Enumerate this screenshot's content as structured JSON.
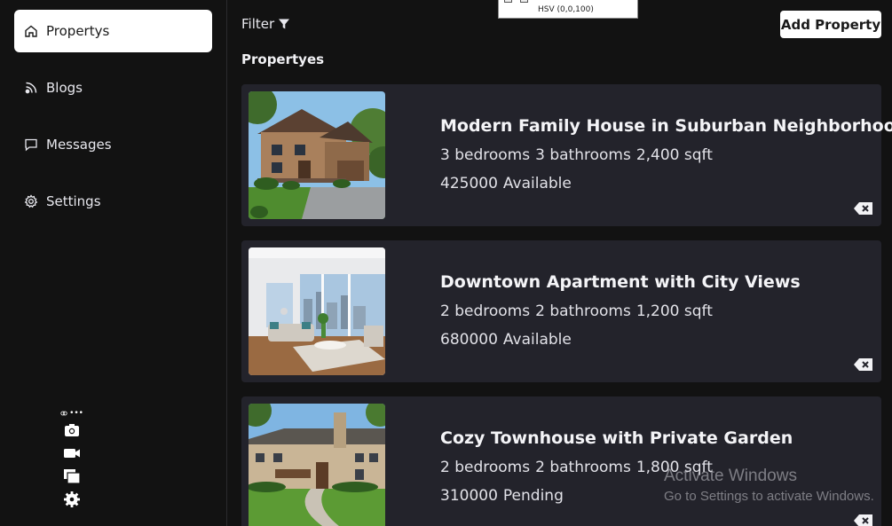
{
  "sidebar": {
    "items": [
      {
        "label": "Propertys",
        "icon": "home-icon",
        "active": true
      },
      {
        "label": "Blogs",
        "icon": "rss-icon",
        "active": false
      },
      {
        "label": "Messages",
        "icon": "message-icon",
        "active": false
      },
      {
        "label": "Settings",
        "icon": "gear-icon",
        "active": false
      }
    ]
  },
  "toolbar": {
    "filter_label": "Filter",
    "add_label": "Add Property"
  },
  "color_popup": {
    "text": "HSV (0,0,100)"
  },
  "main": {
    "section_title": "Propertyes"
  },
  "properties": [
    {
      "title": "Modern Family House in Suburban Neighborhood",
      "bedrooms": "3 bedrooms",
      "bathrooms": "3 bathrooms",
      "area": "2,400 sqft",
      "price": "425000",
      "status": "Available"
    },
    {
      "title": "Downtown Apartment with City Views",
      "bedrooms": "2 bedrooms",
      "bathrooms": "2 bathrooms",
      "area": "1,200 sqft",
      "price": "680000",
      "status": "Available"
    },
    {
      "title": "Cozy Townhouse with Private Garden",
      "bedrooms": "2 bedrooms",
      "bathrooms": "2 bathrooms",
      "area": "1,800 sqft",
      "price": "310000",
      "status": "Pending"
    }
  ],
  "watermark": {
    "line1": "Activate Windows",
    "line2": "Go to Settings to activate Windows."
  },
  "colors": {
    "background": "#121212",
    "card": "#23232b",
    "active_nav": "#ffffff"
  }
}
